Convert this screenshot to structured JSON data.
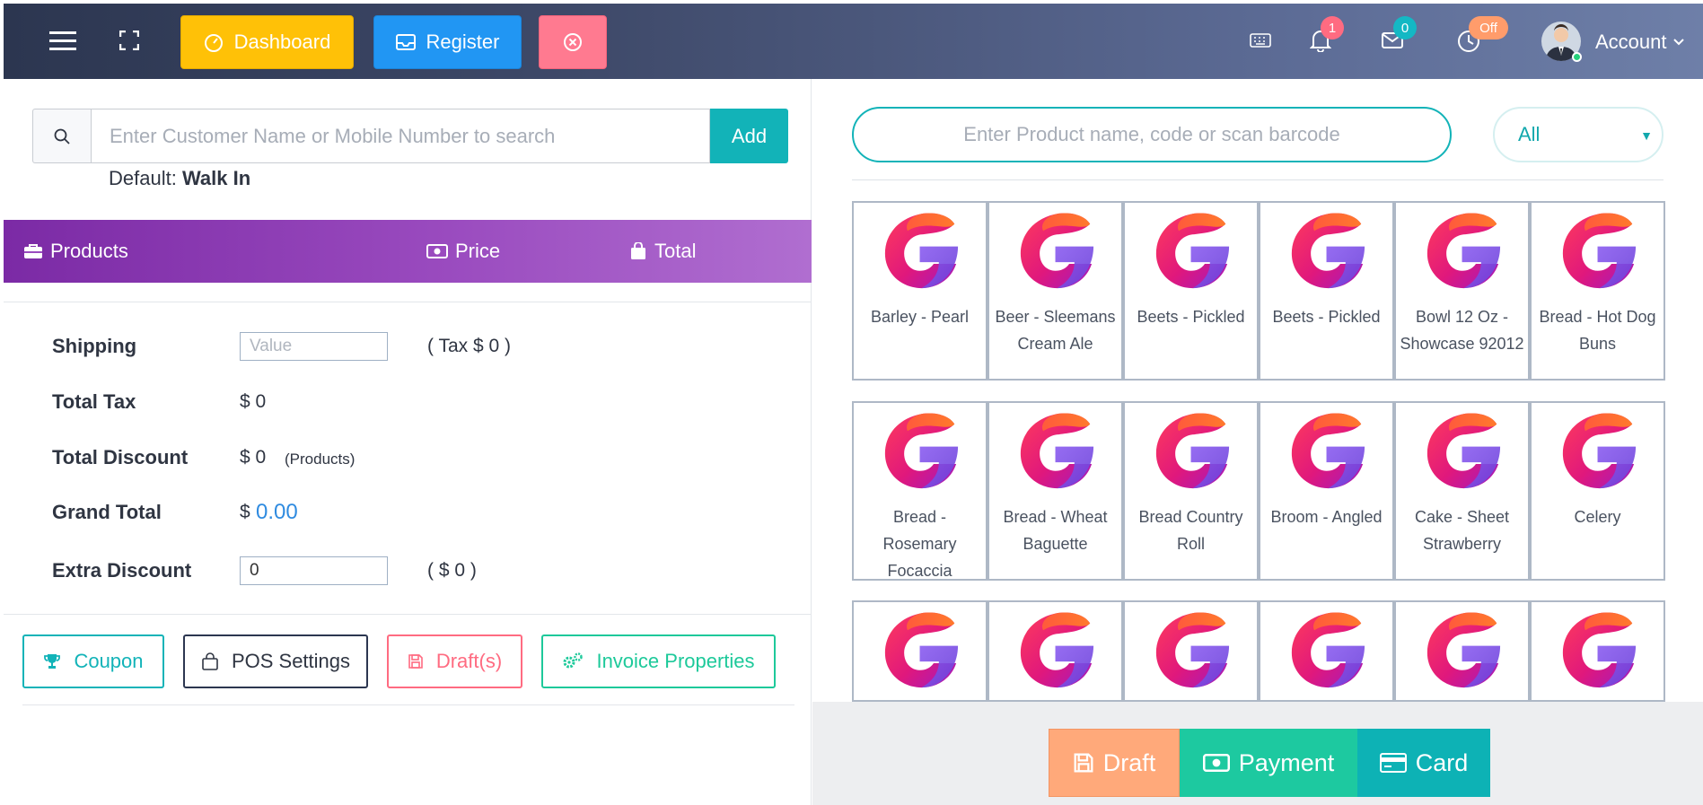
{
  "topbar": {
    "dashboard_label": "Dashboard",
    "register_label": "Register",
    "notifications_count": "1",
    "messages_count": "0",
    "clock_status": "Off",
    "account_label": "Account"
  },
  "customer": {
    "search_placeholder": "Enter Customer Name or Mobile Number to search",
    "add_label": "Add",
    "default_prefix": "Default:",
    "default_value": "Walk In"
  },
  "cart_header": {
    "products": "Products",
    "price": "Price",
    "total": "Total"
  },
  "summary": {
    "shipping_label": "Shipping",
    "shipping_placeholder": "Value",
    "shipping_tax": "( Tax $ 0 )",
    "total_tax_label": "Total Tax",
    "total_tax_value": "$ 0",
    "total_discount_label": "Total Discount",
    "total_discount_value": "$ 0",
    "total_discount_note": "(Products)",
    "grand_total_label": "Grand Total",
    "grand_total_currency": "$",
    "grand_total_value": "0.00",
    "extra_discount_label": "Extra Discount",
    "extra_discount_value": "0",
    "extra_discount_amount": "( $ 0 )"
  },
  "actions": {
    "coupon": "Coupon",
    "pos_settings": "POS Settings",
    "drafts": "Draft(s)",
    "invoice_properties": "Invoice Properties"
  },
  "products": {
    "search_placeholder": "Enter Product name, code or scan barcode",
    "category_selected": "All",
    "items": [
      {
        "name": "Barley - Pearl"
      },
      {
        "name": "Beer - Sleemans Cream Ale"
      },
      {
        "name": "Beets - Pickled"
      },
      {
        "name": "Beets - Pickled"
      },
      {
        "name": "Bowl 12 Oz - Showcase 92012"
      },
      {
        "name": "Bread - Hot Dog Buns"
      },
      {
        "name": "Bread - Rosemary Focaccia"
      },
      {
        "name": "Bread - Wheat Baguette"
      },
      {
        "name": "Bread Country Roll"
      },
      {
        "name": "Broom - Angled"
      },
      {
        "name": "Cake - Sheet Strawberry"
      },
      {
        "name": "Celery"
      },
      {
        "name": ""
      },
      {
        "name": ""
      },
      {
        "name": ""
      },
      {
        "name": ""
      },
      {
        "name": ""
      },
      {
        "name": ""
      }
    ]
  },
  "checkout": {
    "draft": "Draft",
    "payment": "Payment",
    "card": "Card"
  },
  "colors": {
    "dashboard": "#ffc107",
    "register": "#2196f3",
    "close": "#ff7a90",
    "teal": "#12b3b8",
    "draft_btn": "#ffa97a",
    "payment_btn": "#1dc9a0",
    "card_btn": "#0db2b5"
  }
}
